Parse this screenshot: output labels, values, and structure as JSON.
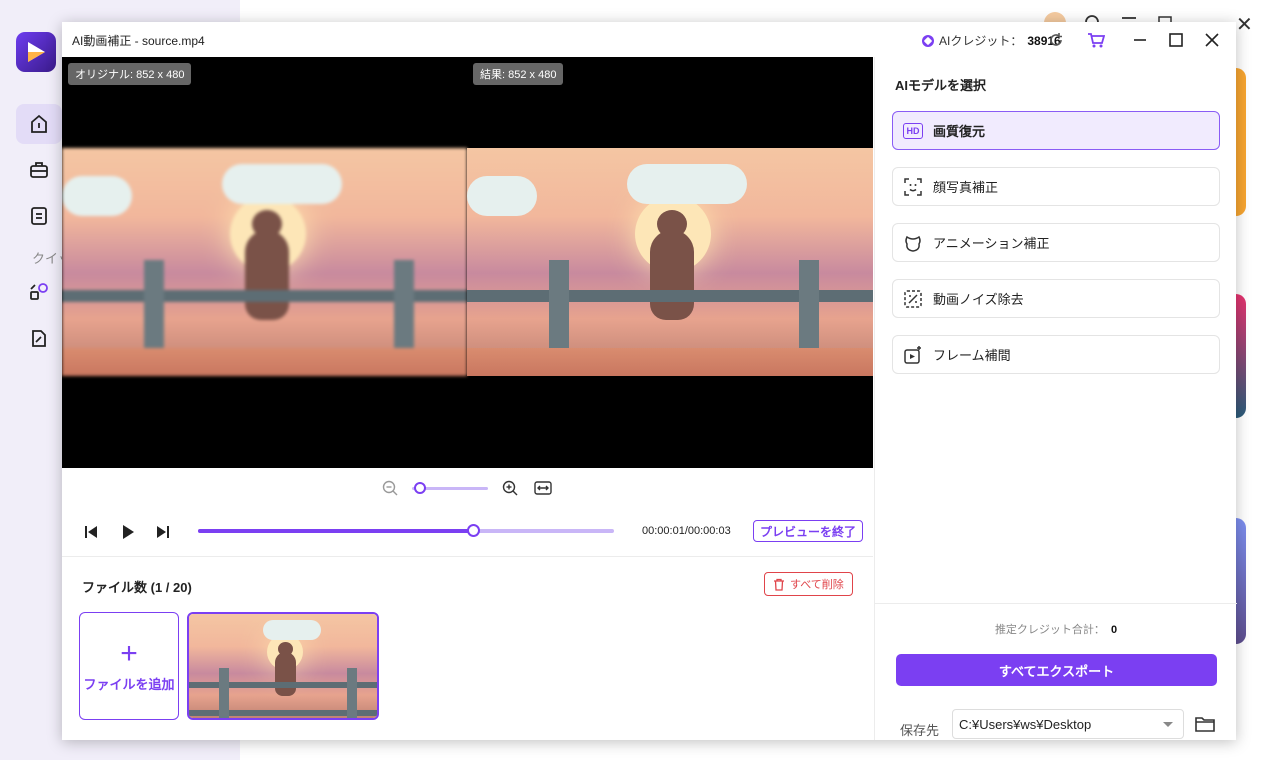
{
  "background_app": {
    "quick_label": "クイッ",
    "nav_icons": [
      "home-icon",
      "toolbox-icon",
      "document-icon",
      "quick-tools-icon",
      "edit-document-icon"
    ]
  },
  "dialog": {
    "title": "AI動画補正 - source.mp4",
    "credit_label": "AIクレジット：",
    "credit_value": "38916"
  },
  "preview": {
    "original_label": "オリジナル: 852 x 480",
    "result_label": "結果: 852 x 480",
    "zoom_level": 0.1
  },
  "playback": {
    "progress": 0.66,
    "timecode": "00:00:01/00:00:03",
    "end_preview_label": "プレビューを終了"
  },
  "files": {
    "count_label": "ファイル数 (1 / 20)",
    "delete_all_label": "すべて削除",
    "add_file_label": "ファイルを追加"
  },
  "ai_panel": {
    "title": "AIモデルを選択",
    "models": [
      {
        "label": "画質復元",
        "icon": "hd-icon",
        "selected": true
      },
      {
        "label": "顔写真補正",
        "icon": "face-scan-icon",
        "selected": false
      },
      {
        "label": "アニメーション補正",
        "icon": "animation-icon",
        "selected": false
      },
      {
        "label": "動画ノイズ除去",
        "icon": "denoise-icon",
        "selected": false
      },
      {
        "label": "フレーム補間",
        "icon": "frame-interpolation-icon",
        "selected": false
      }
    ],
    "estimate_label": "推定クレジット合計：",
    "estimate_value": "0",
    "export_label": "すべてエクスポート",
    "save_label": "保存先",
    "save_path": "C:¥Users¥ws¥Desktop"
  },
  "colors": {
    "accent": "#7b3ff2",
    "danger": "#e0444a"
  }
}
